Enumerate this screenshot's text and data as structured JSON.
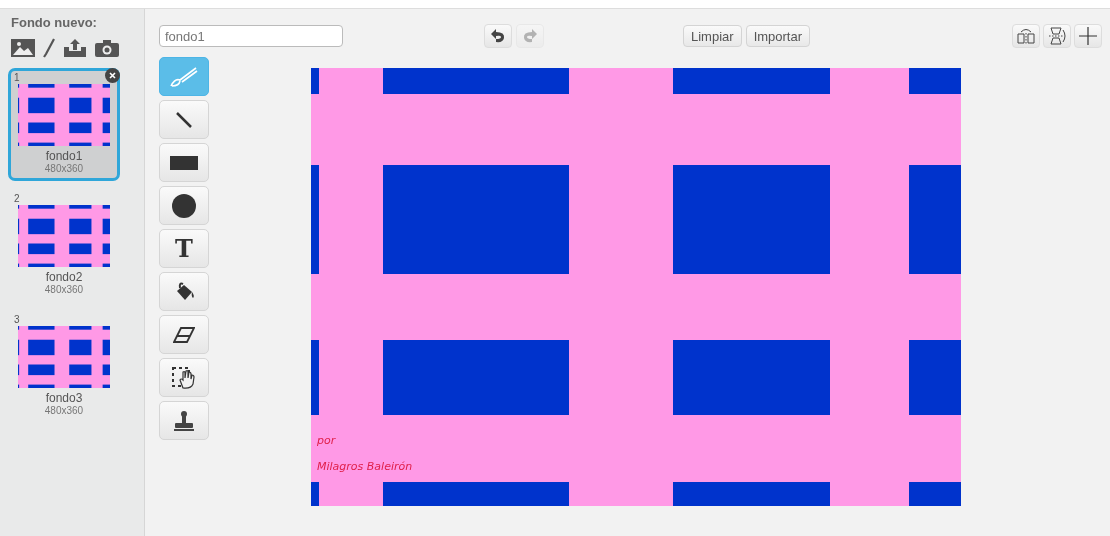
{
  "sidebar": {
    "title": "Fondo nuevo:",
    "costumes": [
      {
        "number": "1",
        "name": "fondo1",
        "size": "480x360",
        "selected": true
      },
      {
        "number": "2",
        "name": "fondo2",
        "size": "480x360",
        "selected": false
      },
      {
        "number": "3",
        "name": "fondo3",
        "size": "480x360",
        "selected": false
      }
    ]
  },
  "name_field": {
    "value": "fondo1"
  },
  "history": [
    {
      "kind": "undo",
      "disabled": false
    },
    {
      "kind": "redo",
      "disabled": true
    }
  ],
  "actions": [
    "Limpiar",
    "Importar"
  ],
  "tools": [
    {
      "kind": "brush",
      "selected": true
    },
    {
      "kind": "line",
      "selected": false
    },
    {
      "kind": "rect",
      "selected": false
    },
    {
      "kind": "ellipse",
      "selected": false
    },
    {
      "kind": "text",
      "label": "T",
      "selected": false
    },
    {
      "kind": "fill",
      "selected": false
    },
    {
      "kind": "eraser",
      "selected": false
    },
    {
      "kind": "select",
      "selected": false
    },
    {
      "kind": "stamp",
      "selected": false
    }
  ],
  "canvas": {
    "texts": [
      "por",
      "Milagros Baleirón"
    ]
  }
}
